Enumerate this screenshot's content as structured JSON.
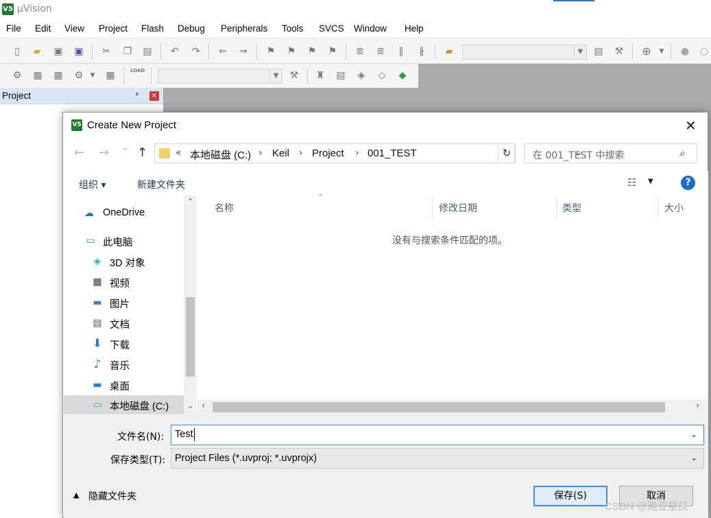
{
  "app": {
    "logo_text": "V5",
    "title": "µVision"
  },
  "menu": [
    "File",
    "Edit",
    "View",
    "Project",
    "Flash",
    "Debug",
    "Peripherals",
    "Tools",
    "SVCS",
    "Window",
    "Help"
  ],
  "toolbar": {
    "row1_icons": [
      "new-file-icon",
      "open-file-icon",
      "save-icon",
      "save-all-icon",
      "cut-icon",
      "copy-icon",
      "paste-icon",
      "undo-icon",
      "redo-icon",
      "nav-back-icon",
      "nav-forward-icon",
      "bookmark-set-icon",
      "bookmark-prev-icon",
      "bookmark-next-icon",
      "bookmark-clear-icon",
      "indent-icon",
      "unindent-icon",
      "comment-icon",
      "uncomment-icon",
      "find-in-files-icon",
      "find-icon",
      "incremental-find-icon",
      "debug-session-icon",
      "breakpoint-icon",
      "breakpoint-disable-icon"
    ],
    "row2_icons": [
      "translate-icon",
      "build-icon",
      "rebuild-icon",
      "batch-build-icon",
      "stop-build-icon",
      "download-icon",
      "target-options-icon",
      "manage-components-icon",
      "pack-installer-icon",
      "select-packs-icon",
      "runtime-env-icon"
    ],
    "load_label": "LOAD"
  },
  "project_panel": {
    "title": "Project",
    "pin": "ᵖ",
    "close": "×"
  },
  "dialog": {
    "logo_text": "V5",
    "title": "Create New Project",
    "close": "✕",
    "nav": {
      "back": "←",
      "forward": "→",
      "recent": "⌄",
      "up": "↑"
    },
    "breadcrumb_prefix": "«",
    "breadcrumb": [
      "本地磁盘 (C:)",
      "Keil",
      "Project",
      "001_TEST"
    ],
    "search_placeholder": "在 001_TEST 中搜索",
    "organize": "组织 ▾",
    "new_folder": "新建文件夹",
    "help": "?",
    "nav_items": [
      {
        "label": "OneDrive",
        "icon": "onedrive-icon"
      },
      {
        "label": "此电脑",
        "icon": "this-pc-icon"
      },
      {
        "label": "3D 对象",
        "icon": "3d-objects-icon"
      },
      {
        "label": "视频",
        "icon": "video-icon"
      },
      {
        "label": "图片",
        "icon": "pictures-icon"
      },
      {
        "label": "文档",
        "icon": "documents-icon"
      },
      {
        "label": "下载",
        "icon": "download-icon"
      },
      {
        "label": "音乐",
        "icon": "music-icon"
      },
      {
        "label": "桌面",
        "icon": "desktop-icon"
      },
      {
        "label": "本地磁盘 (C:)",
        "icon": "local-disk-icon"
      }
    ],
    "columns": [
      "名称",
      "修改日期",
      "类型",
      "大小"
    ],
    "empty_message": "没有与搜索条件匹配的项。",
    "file_name_label": "文件名(N):",
    "file_name_value": "Test",
    "file_type_label": "保存类型(T):",
    "file_type_value": "Project Files (*.uvproj; *.uvprojx)",
    "hide_folders": "隐藏文件夹",
    "save_button": "保存(S)",
    "cancel_button": "取消"
  },
  "watermark": "CSDN @路亚星辰",
  "colors": {
    "accent": "#3c8fd6",
    "app_logo": "#1f7a2c",
    "help": "#1a6cd1",
    "selected_nav": "#d9d9d9"
  }
}
